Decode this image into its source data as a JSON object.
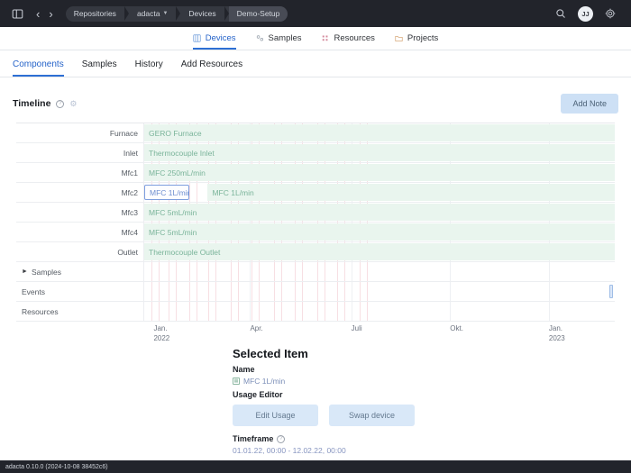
{
  "topbar": {
    "panel_icon": "panel-toggle-icon",
    "back_label": "‹",
    "forward_label": "›",
    "breadcrumb": [
      {
        "label": "Repositories",
        "caret": false
      },
      {
        "label": "adacta",
        "caret": true
      },
      {
        "label": "Devices",
        "caret": false
      },
      {
        "label": "Demo-Setup",
        "caret": false
      }
    ],
    "search_icon": "search-icon",
    "avatar_initials": "JJ",
    "settings_icon": "gear-icon"
  },
  "mainnav": [
    {
      "label": "Devices",
      "icon": "devices-icon",
      "active": true
    },
    {
      "label": "Samples",
      "icon": "samples-icon",
      "active": false
    },
    {
      "label": "Resources",
      "icon": "resources-icon",
      "active": false
    },
    {
      "label": "Projects",
      "icon": "projects-icon",
      "active": false
    }
  ],
  "subnav": [
    {
      "label": "Components",
      "active": true
    },
    {
      "label": "Samples",
      "active": false
    },
    {
      "label": "History",
      "active": false
    },
    {
      "label": "Add Resources",
      "active": false
    }
  ],
  "timeline": {
    "title": "Timeline",
    "help_icon": "question-icon",
    "settings_icon": "gear-icon",
    "add_note_label": "Add Note",
    "rows": [
      {
        "label": "Furnace",
        "bars": [
          {
            "text": "GERO Furnace",
            "left_pct": 0,
            "width_pct": 100,
            "selected": false
          }
        ]
      },
      {
        "label": "Inlet",
        "bars": [
          {
            "text": "Thermocouple Inlet",
            "left_pct": 0,
            "width_pct": 100,
            "selected": false
          }
        ]
      },
      {
        "label": "Mfc1",
        "bars": [
          {
            "text": "MFC 250mL/min",
            "left_pct": 0,
            "width_pct": 100,
            "selected": false
          }
        ]
      },
      {
        "label": "Mfc2",
        "bars": [
          {
            "text": "MFC 1L/min",
            "left_pct": 0,
            "width_pct": 9.5,
            "selected": true
          },
          {
            "text": "MFC 1L/min",
            "left_pct": 13.5,
            "width_pct": 86.5,
            "selected": false
          }
        ]
      },
      {
        "label": "Mfc3",
        "bars": [
          {
            "text": "MFC 5mL/min",
            "left_pct": 0,
            "width_pct": 100,
            "selected": false
          }
        ]
      },
      {
        "label": "Mfc4",
        "bars": [
          {
            "text": "MFC 5mL/min",
            "left_pct": 0,
            "width_pct": 100,
            "selected": false
          }
        ]
      },
      {
        "label": "Outlet",
        "bars": [
          {
            "text": "Thermocouple Outlet",
            "left_pct": 0,
            "width_pct": 100,
            "selected": false
          }
        ]
      }
    ],
    "group_rows": [
      {
        "label": "Samples",
        "expandable": true
      },
      {
        "label": "Events",
        "expandable": false
      },
      {
        "label": "Resources",
        "expandable": false
      }
    ],
    "axis_ticks": [
      {
        "line1": "Jan.",
        "line2": "2022",
        "pos_pct": 2
      },
      {
        "line1": "Apr.",
        "line2": "",
        "pos_pct": 22.5
      },
      {
        "line1": "Juli",
        "line2": "",
        "pos_pct": 44
      },
      {
        "line1": "Okt.",
        "line2": "",
        "pos_pct": 65
      },
      {
        "line1": "Jan.",
        "line2": "2023",
        "pos_pct": 86
      }
    ]
  },
  "selected_item": {
    "heading": "Selected Item",
    "name_label": "Name",
    "name_value": "MFC 1L/min",
    "usage_label": "Usage Editor",
    "edit_usage_label": "Edit Usage",
    "swap_device_label": "Swap device",
    "timeframe_label": "Timeframe",
    "timeframe_help_icon": "question-icon",
    "timeframe_value": "01.01.22, 00:00 - 12.02.22, 00:00"
  },
  "footer": {
    "version_text": "adacta 0.10.0 (2024-10-08 38452c6)"
  },
  "colors": {
    "accent": "#2d6fd4",
    "bar_fill": "#e9f5ee",
    "bar_text": "#7ab49a",
    "topbar": "#22242b",
    "gridline": "#f7dfe3"
  }
}
